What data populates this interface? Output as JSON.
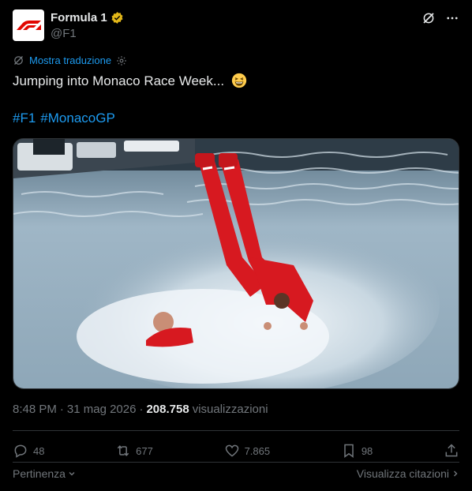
{
  "author": {
    "display_name": "Formula 1",
    "handle": "@F1",
    "avatar_icon": "f1-logo-icon",
    "verified_badge_icon": "verified-gold-badge-icon"
  },
  "header_actions": {
    "grok_icon": "grok-icon",
    "more_icon": "more-dots-icon"
  },
  "translation": {
    "label": "Mostra traduzione"
  },
  "tweet": {
    "text": "Jumping into Monaco Race Week...",
    "emoji_icon": "grinning-squinting-face-icon",
    "hashtags": [
      "#F1",
      "#MonacoGP"
    ]
  },
  "media": {
    "icon": "diving-photo"
  },
  "meta": {
    "time": "8:48 PM",
    "separator": "·",
    "date": "31 mag 2026",
    "separator2": "·",
    "views_count": "208.758",
    "views_label": "visualizzazioni"
  },
  "actions": {
    "replies": "48",
    "reposts": "677",
    "likes": "7.865",
    "bookmarks": "98"
  },
  "footer": {
    "left": "Pertinenza",
    "right": "Visualizza citazioni"
  },
  "colors": {
    "accent": "#1d9bf0",
    "text": "#e7e9ea",
    "muted": "#71767b",
    "f1_red": "#e10600"
  }
}
